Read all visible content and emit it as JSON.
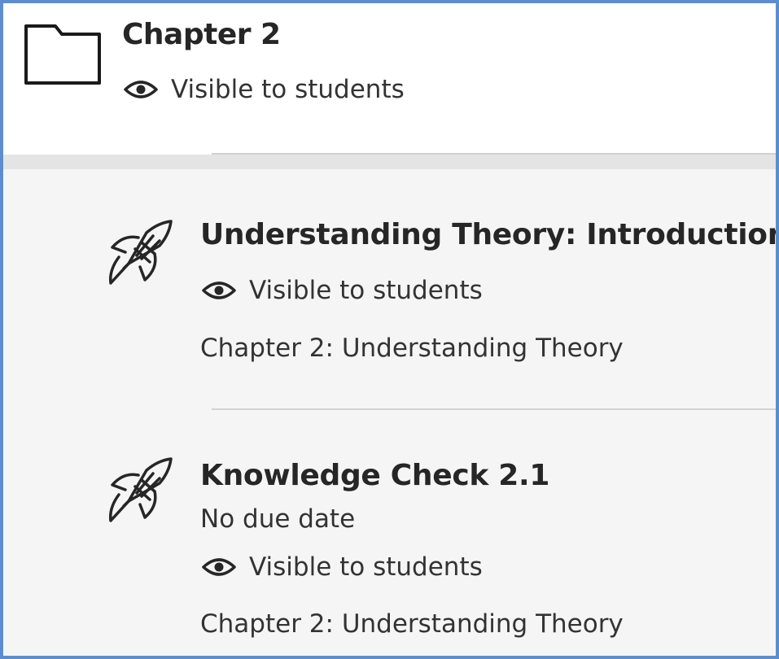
{
  "folder": {
    "icon": "folder-icon",
    "title": "Chapter 2",
    "visibility_icon": "eye-icon",
    "visibility": "Visible to students"
  },
  "items": [
    {
      "icon": "rocket-icon",
      "title": "Understanding Theory: Introduction",
      "visibility_icon": "eye-icon",
      "visibility": "Visible to students",
      "location": "Chapter 2: Understanding Theory"
    },
    {
      "icon": "rocket-icon",
      "title": "Knowledge Check 2.1",
      "due": "No due date",
      "visibility_icon": "eye-icon",
      "visibility": "Visible to students",
      "location": "Chapter 2: Understanding Theory"
    }
  ],
  "colors": {
    "frame_border": "#5b8ed0",
    "nested_background": "#f5f5f5",
    "text": "#262626"
  }
}
